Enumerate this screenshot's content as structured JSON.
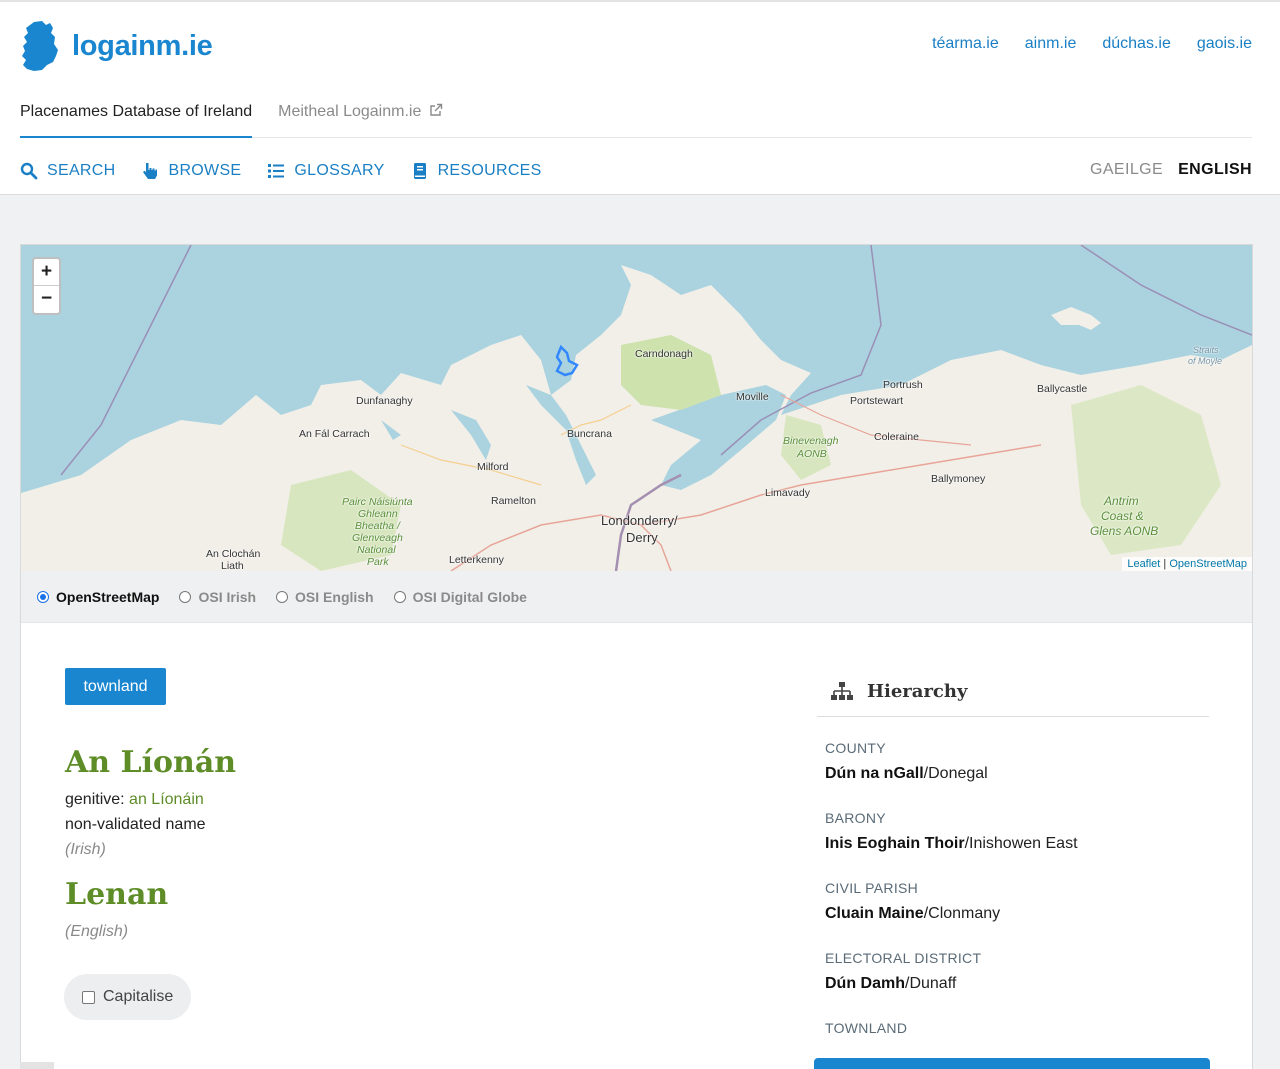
{
  "site": {
    "name": "logainm.ie"
  },
  "external_links": [
    "téarma.ie",
    "ainm.ie",
    "dúchas.ie",
    "gaois.ie"
  ],
  "subnav": {
    "active": "Placenames Database of Ireland",
    "other": "Meitheal Logainm.ie"
  },
  "mainnav": [
    {
      "label": "SEARCH",
      "icon": "search-icon"
    },
    {
      "label": "BROWSE",
      "icon": "pointer-hand-icon"
    },
    {
      "label": "GLOSSARY",
      "icon": "list-icon"
    },
    {
      "label": "RESOURCES",
      "icon": "book-icon"
    }
  ],
  "languages": {
    "irish": "GAEILGE",
    "english": "ENGLISH",
    "selected": "ENGLISH"
  },
  "map": {
    "zoom_in": "+",
    "zoom_out": "−",
    "attribution_leaflet": "Leaflet",
    "attribution_sep": " | ",
    "attribution_osm": "OpenStreetMap",
    "labels": {
      "carndonagh": "Carndonagh",
      "moville": "Moville",
      "portrush": "Portrush",
      "portstewart": "Portstewart",
      "ballycastle": "Ballycastle",
      "coleraine": "Coleraine",
      "dunfanaghy": "Dunfanaghy",
      "anfalcarrach": "An Fál Carrach",
      "buncrana": "Buncrana",
      "milford": "Milford",
      "ramelton": "Ramelton",
      "limavady": "Limavady",
      "ballymoney": "Ballymoney",
      "londonderry": "Londonderry/",
      "derry": "Derry",
      "letterkenny": "Letterkenny",
      "anclochan": "An Clochán",
      "liath": "Liath",
      "binevenagh": "Binevenagh",
      "aonb": "AONB",
      "pairc1": "Pairc Náisiúnta",
      "pairc2": "Ghleann",
      "pairc3": "Bheatha /",
      "pairc4": "Glenveagh",
      "pairc5": "National",
      "pairc6": "Park",
      "antrim1": "Antrim",
      "antrim2": "Coast &",
      "antrim3": "Glens AONB",
      "straits1": "Straits",
      "straits2": "of Moyle"
    }
  },
  "layers": [
    {
      "label": "OpenStreetMap",
      "checked": true
    },
    {
      "label": "OSI Irish",
      "checked": false
    },
    {
      "label": "OSI English",
      "checked": false
    },
    {
      "label": "OSI Digital Globe",
      "checked": false
    }
  ],
  "place": {
    "type": "townland",
    "irish_name": "An Líonán",
    "genitive_label": "genitive: ",
    "genitive_value": "an Líonáin",
    "validation": "non-validated name",
    "irish_lang": "(Irish)",
    "english_name": "Lenan",
    "english_lang": "(English)",
    "capitalise_label": "Capitalise"
  },
  "hierarchy": {
    "title": "Hierarchy",
    "items": [
      {
        "label": "COUNTY",
        "irish": "Dún na nGall",
        "english": "/Donegal"
      },
      {
        "label": "BARONY",
        "irish": "Inis Eoghain Thoir",
        "english": "/Inishowen East"
      },
      {
        "label": "CIVIL PARISH",
        "irish": "Cluain Maine",
        "english": "/Clonmany"
      },
      {
        "label": "ELECTORAL DISTRICT",
        "irish": "Dún Damh",
        "english": "/Dunaff"
      },
      {
        "label": "TOWNLAND"
      }
    ]
  },
  "colors": {
    "brand_blue": "#1a86d0",
    "name_green": "#5e8d27",
    "sea": "#aad3df"
  }
}
